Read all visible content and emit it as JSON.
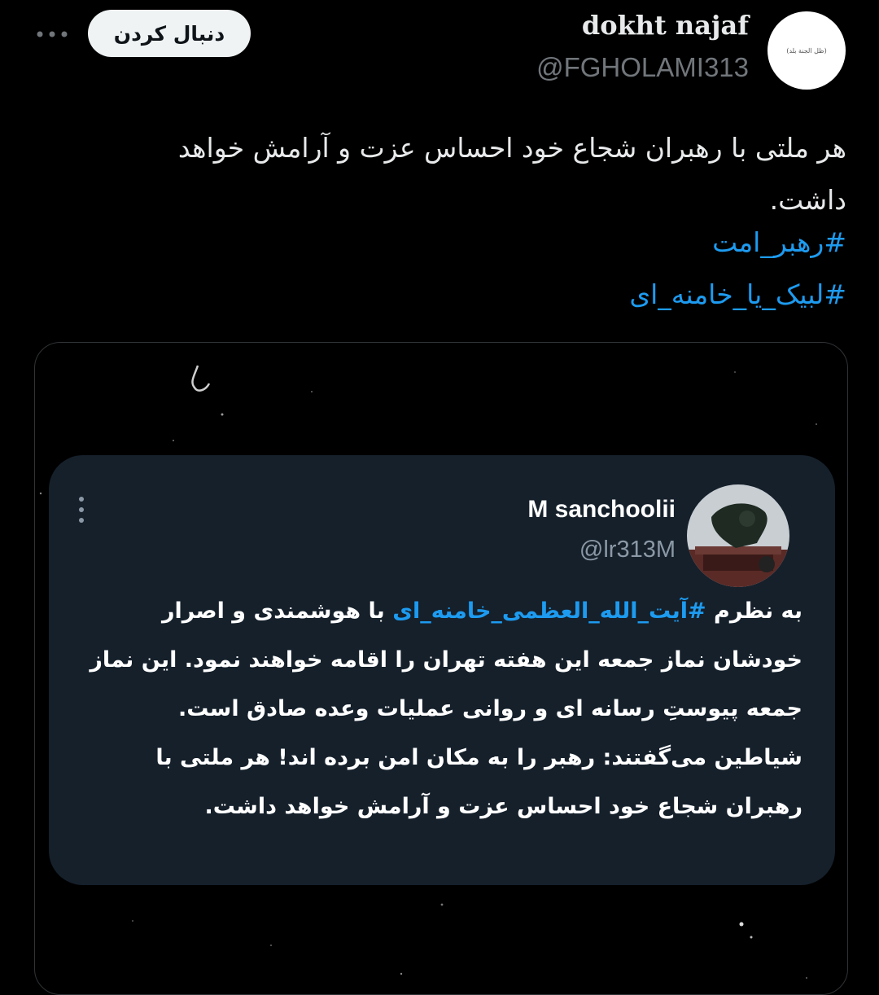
{
  "user": {
    "display_name": "dokht najaf",
    "handle": "@FGHOLAMI313",
    "avatar_text": "(ظل الجنة بلد)"
  },
  "follow_button": {
    "label": "دنبال کردن"
  },
  "more_button": {
    "icon": "more-horizontal-icon"
  },
  "tweet": {
    "text": "هر ملتی با رهبران شجاع خود احساس عزت و آرامش خواهد داشت.",
    "hashtags": [
      "#رهبر_امت",
      "#لبیک_یا_خامنه_ای"
    ]
  },
  "media": {
    "quoted_tweet": {
      "display_name": "M sanchoolii",
      "handle": "@lr313M",
      "text_before": "به نظرم ",
      "hashtag": "#آیت_الله_العظمی_خامنه_ای",
      "text_after": " با هوشمندی و اصرار خودشان نماز جمعه این هفته تهران را اقامه خواهند نمود. این نماز جمعه پیوستِ رسانه ای و روانی عملیات وعده صادق است. شیاطین می‌گفتند: رهبر را به مکان امن برده اند! هر ملتی با رهبران شجاع خود احساس عزت و آرامش خواهد داشت.",
      "menu_icon": "more-vertical-icon"
    }
  },
  "colors": {
    "background": "#000000",
    "text_primary": "#e7e9ea",
    "text_secondary": "#71767b",
    "link": "#1d9bf0",
    "follow_button_bg": "#eff3f4",
    "inner_card_bg": "#15202b"
  }
}
